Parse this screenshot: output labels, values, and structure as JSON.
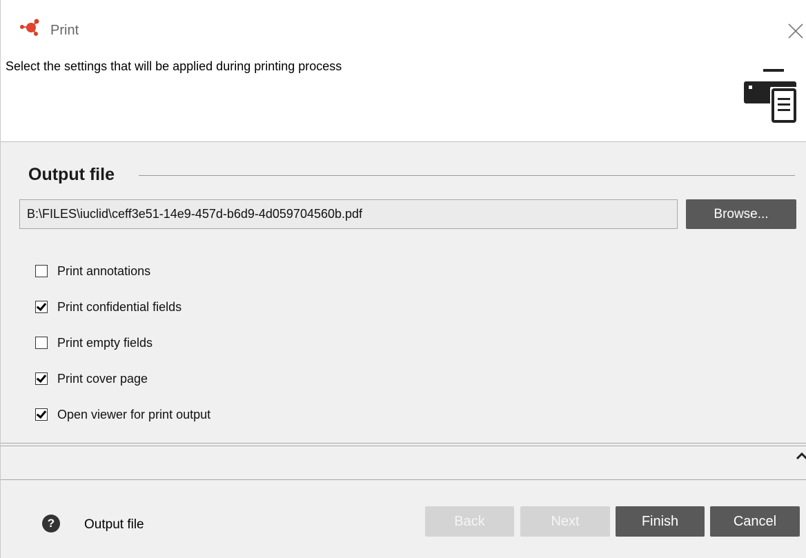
{
  "window": {
    "title": "Print",
    "close_icon": "close-icon",
    "app_icon": "molecule-icon"
  },
  "header": {
    "instruction": "Select the settings that will be applied during printing process",
    "icon": "printer-icon"
  },
  "output_file": {
    "section_title": "Output file",
    "path_value": "B:\\FILES\\iuclid\\ceff3e51-14e9-457d-b6d9-4d059704560b.pdf",
    "browse_label": "Browse..."
  },
  "options": [
    {
      "label": "Print annotations",
      "checked": false
    },
    {
      "label": "Print confidential fields",
      "checked": true
    },
    {
      "label": "Print empty fields",
      "checked": false
    },
    {
      "label": "Print cover page",
      "checked": true
    },
    {
      "label": "Open viewer for print output",
      "checked": true
    }
  ],
  "footer": {
    "help_icon": "help-icon",
    "help_text": "Output file",
    "back_label": "Back",
    "next_label": "Next",
    "finish_label": "Finish",
    "cancel_label": "Cancel"
  },
  "colors": {
    "accent": "#d9402b",
    "button": "#595959",
    "button_disabled": "#d4d4d4"
  }
}
